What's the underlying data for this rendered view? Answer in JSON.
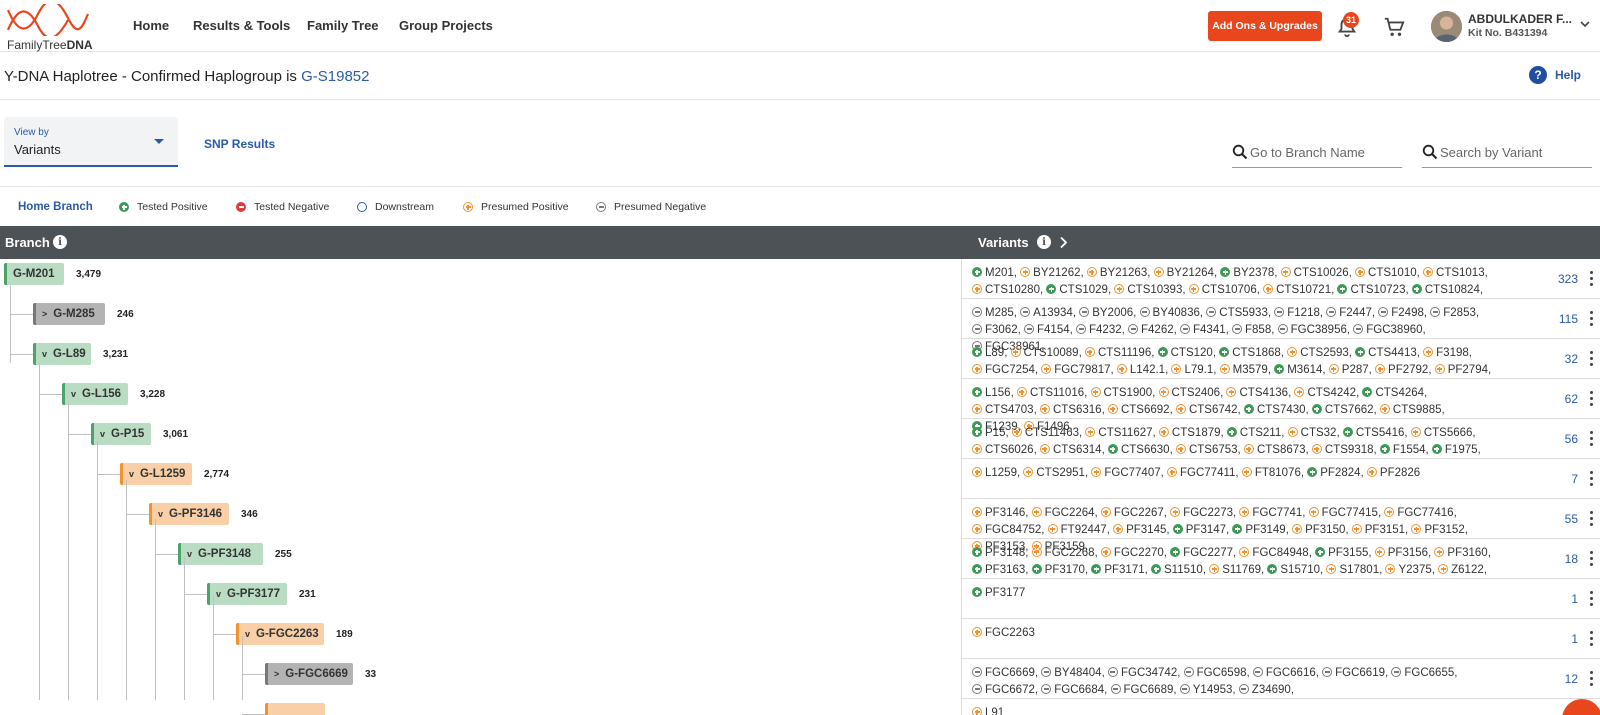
{
  "header": {
    "logo_text_a": "FamilyTree",
    "logo_text_b": "DNA",
    "nav": [
      "Home",
      "Results & Tools",
      "Family Tree",
      "Group Projects"
    ],
    "addons_label": "Add Ons & Upgrades",
    "notification_count": "31",
    "user_name": "ABDULKADER F...",
    "kit_number": "Kit No. B431394"
  },
  "titlebar": {
    "title_prefix": "Y-DNA Haplotree - Confirmed Haplogroup is ",
    "haplogroup": "G-S19852",
    "help_label": "Help"
  },
  "controls": {
    "viewby_label": "View by",
    "viewby_value": "Variants",
    "snp_results_label": "SNP Results",
    "branch_search_placeholder": "Go to Branch Name",
    "variant_search_placeholder": "Search by Variant"
  },
  "legend": {
    "home_branch": "Home Branch",
    "tested_positive": "Tested Positive",
    "tested_negative": "Tested Negative",
    "downstream": "Downstream",
    "presumed_positive": "Presumed Positive",
    "presumed_negative": "Presumed Negative"
  },
  "table": {
    "branch_header": "Branch",
    "variants_header": "Variants"
  },
  "colors": {
    "brand_orange": "#e8471d",
    "link_blue": "#2a5aa8",
    "positive_green": "#3c9a55",
    "presumed_orange": "#f0932e",
    "header_gray": "#4d5256"
  },
  "rows": [
    {
      "branch": "G-M201",
      "count": "3,479",
      "style": "green",
      "chevron": "",
      "variant_count": "323",
      "variants": [
        [
          "p",
          "M201"
        ],
        [
          "pp",
          "BY21262"
        ],
        [
          "pp",
          "BY21263"
        ],
        [
          "pp",
          "BY21264"
        ],
        [
          "p",
          "BY2378"
        ],
        [
          "pp",
          "CTS10026"
        ],
        [
          "pp",
          "CTS1010"
        ],
        [
          "pp",
          "CTS1013"
        ],
        [
          "pp",
          "CTS10280"
        ],
        [
          "p",
          "CTS1029"
        ],
        [
          "pp",
          "CTS10393"
        ],
        [
          "pp",
          "CTS10706"
        ],
        [
          "pp",
          "CTS10721"
        ],
        [
          "p",
          "CTS10723"
        ],
        [
          "p",
          "CTS10824"
        ]
      ]
    },
    {
      "branch": "G-M285",
      "count": "246",
      "style": "gray",
      "chevron": "›",
      "variant_count": "115",
      "variants": [
        [
          "n",
          "M285"
        ],
        [
          "n",
          "A13934"
        ],
        [
          "n",
          "BY2006"
        ],
        [
          "n",
          "BY40836"
        ],
        [
          "n",
          "CTS5933"
        ],
        [
          "n",
          "F1218"
        ],
        [
          "n",
          "F2447"
        ],
        [
          "n",
          "F2498"
        ],
        [
          "n",
          "F2853"
        ],
        [
          "n",
          "F3062"
        ],
        [
          "n",
          "F4154"
        ],
        [
          "n",
          "F4232"
        ],
        [
          "n",
          "F4262"
        ],
        [
          "n",
          "F4341"
        ],
        [
          "n",
          "F858"
        ],
        [
          "n",
          "FGC38956"
        ],
        [
          "n",
          "FGC38960"
        ],
        [
          "n",
          "FGC38961"
        ]
      ]
    },
    {
      "branch": "G-L89",
      "count": "3,231",
      "style": "green",
      "chevron": "˅",
      "variant_count": "32",
      "variants": [
        [
          "p",
          "L89"
        ],
        [
          "pp",
          "CTS10089"
        ],
        [
          "pp",
          "CTS11196"
        ],
        [
          "p",
          "CTS120"
        ],
        [
          "p",
          "CTS1868"
        ],
        [
          "pp",
          "CTS2593"
        ],
        [
          "p",
          "CTS4413"
        ],
        [
          "pp",
          "F3198"
        ],
        [
          "pp",
          "FGC7254"
        ],
        [
          "pp",
          "FGC79817"
        ],
        [
          "pp",
          "L142.1"
        ],
        [
          "pp",
          "L79.1"
        ],
        [
          "pp",
          "M3579"
        ],
        [
          "p",
          "M3614"
        ],
        [
          "pp",
          "P287"
        ],
        [
          "pp",
          "PF2792"
        ],
        [
          "pp",
          "PF2794"
        ]
      ]
    },
    {
      "branch": "G-L156",
      "count": "3,228",
      "style": "green",
      "chevron": "˅",
      "variant_count": "62",
      "variants": [
        [
          "p",
          "L156"
        ],
        [
          "pp",
          "CTS11016"
        ],
        [
          "pp",
          "CTS1900"
        ],
        [
          "pp",
          "CTS2406"
        ],
        [
          "pp",
          "CTS4136"
        ],
        [
          "pp",
          "CTS4242"
        ],
        [
          "p",
          "CTS4264"
        ],
        [
          "pp",
          "CTS4703"
        ],
        [
          "pp",
          "CTS6316"
        ],
        [
          "pp",
          "CTS6692"
        ],
        [
          "pp",
          "CTS6742"
        ],
        [
          "p",
          "CTS7430"
        ],
        [
          "p",
          "CTS7662"
        ],
        [
          "pp",
          "CTS9885"
        ],
        [
          "p",
          "F1239"
        ],
        [
          "pp",
          "F1496"
        ]
      ]
    },
    {
      "branch": "G-P15",
      "count": "3,061",
      "style": "green",
      "chevron": "˅",
      "variant_count": "56",
      "variants": [
        [
          "p",
          "P15"
        ],
        [
          "pp",
          "CTS11463"
        ],
        [
          "pp",
          "CTS11627"
        ],
        [
          "pp",
          "CTS1879"
        ],
        [
          "p",
          "CTS211"
        ],
        [
          "pp",
          "CTS32"
        ],
        [
          "p",
          "CTS5416"
        ],
        [
          "pp",
          "CTS5666"
        ],
        [
          "pp",
          "CTS6026"
        ],
        [
          "pp",
          "CTS6314"
        ],
        [
          "p",
          "CTS6630"
        ],
        [
          "pp",
          "CTS6753"
        ],
        [
          "pp",
          "CTS8673"
        ],
        [
          "pp",
          "CTS9318"
        ],
        [
          "p",
          "F1554"
        ],
        [
          "p",
          "F1975"
        ]
      ]
    },
    {
      "branch": "G-L1259",
      "count": "2,774",
      "style": "orange",
      "chevron": "˅",
      "variant_count": "7",
      "variants": [
        [
          "pp",
          "L1259"
        ],
        [
          "pp",
          "CTS2951"
        ],
        [
          "pp",
          "FGC77407"
        ],
        [
          "pp",
          "FGC77411"
        ],
        [
          "pp",
          "FT81076"
        ],
        [
          "p",
          "PF2824"
        ],
        [
          "pp",
          "PF2826"
        ]
      ]
    },
    {
      "branch": "G-PF3146",
      "count": "346",
      "style": "orange",
      "chevron": "˅",
      "variant_count": "55",
      "variants": [
        [
          "pp",
          "PF3146"
        ],
        [
          "pp",
          "FGC2264"
        ],
        [
          "pp",
          "FGC2267"
        ],
        [
          "pp",
          "FGC2273"
        ],
        [
          "pp",
          "FGC7741"
        ],
        [
          "pp",
          "FGC77415"
        ],
        [
          "pp",
          "FGC77416"
        ],
        [
          "pp",
          "FGC84752"
        ],
        [
          "pp",
          "FT92447"
        ],
        [
          "pp",
          "PF3145"
        ],
        [
          "p",
          "PF3147"
        ],
        [
          "p",
          "PF3149"
        ],
        [
          "pp",
          "PF3150"
        ],
        [
          "pp",
          "PF3151"
        ],
        [
          "pp",
          "PF3152"
        ],
        [
          "pp",
          "PF3153"
        ],
        [
          "pp",
          "PF3159"
        ]
      ]
    },
    {
      "branch": "G-PF3148",
      "count": "255",
      "style": "green",
      "chevron": "˅",
      "variant_count": "18",
      "variants": [
        [
          "p",
          "PF3148"
        ],
        [
          "pp",
          "FGC2268"
        ],
        [
          "pp",
          "FGC2270"
        ],
        [
          "p",
          "FGC2277"
        ],
        [
          "pp",
          "FGC84948"
        ],
        [
          "p",
          "PF3155"
        ],
        [
          "pp",
          "PF3156"
        ],
        [
          "pp",
          "PF3160"
        ],
        [
          "p",
          "PF3163"
        ],
        [
          "p",
          "PF3170"
        ],
        [
          "p",
          "PF3171"
        ],
        [
          "p",
          "S11510"
        ],
        [
          "pp",
          "S11769"
        ],
        [
          "p",
          "S15710"
        ],
        [
          "pp",
          "S17801"
        ],
        [
          "pp",
          "Y2375"
        ],
        [
          "pp",
          "Z6122"
        ]
      ]
    },
    {
      "branch": "G-PF3177",
      "count": "231",
      "style": "green",
      "chevron": "˅",
      "variant_count": "1",
      "variants": [
        [
          "p",
          "PF3177"
        ]
      ]
    },
    {
      "branch": "G-FGC2263",
      "count": "189",
      "style": "orange",
      "chevron": "˅",
      "variant_count": "1",
      "variants": [
        [
          "pp",
          "FGC2263"
        ]
      ]
    },
    {
      "branch": "G-FGC6669",
      "count": "33",
      "style": "gray",
      "chevron": "›",
      "variant_count": "12",
      "variants": [
        [
          "n",
          "FGC6669"
        ],
        [
          "n",
          "BY48404"
        ],
        [
          "n",
          "FGC34742"
        ],
        [
          "n",
          "FGC6598"
        ],
        [
          "n",
          "FGC6616"
        ],
        [
          "n",
          "FGC6619"
        ],
        [
          "n",
          "FGC6655"
        ],
        [
          "n",
          "FGC6672"
        ],
        [
          "n",
          "FGC6684"
        ],
        [
          "n",
          "FGC6689"
        ],
        [
          "n",
          "Y14953"
        ],
        [
          "n",
          "Z34690"
        ]
      ]
    },
    {
      "branch": "",
      "count": "",
      "style": "orange",
      "chevron": "",
      "variant_count": "",
      "variants": [
        [
          "pp",
          "L91"
        ]
      ]
    }
  ]
}
